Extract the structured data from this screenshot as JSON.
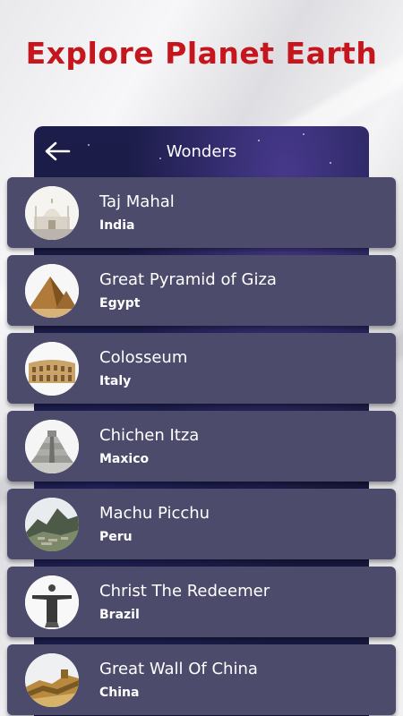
{
  "app": {
    "title": "Explore Planet Earth"
  },
  "header": {
    "title": "Wonders",
    "back_icon": "arrow-left-icon"
  },
  "wonders": [
    {
      "name": "Taj Mahal",
      "country": "India",
      "icon": "taj-mahal-icon"
    },
    {
      "name": "Great Pyramid of Giza",
      "country": "Egypt",
      "icon": "pyramid-icon"
    },
    {
      "name": "Colosseum",
      "country": "Italy",
      "icon": "colosseum-icon"
    },
    {
      "name": "Chichen Itza",
      "country": "Maxico",
      "icon": "chichen-itza-icon"
    },
    {
      "name": "Machu Picchu",
      "country": "Peru",
      "icon": "machu-picchu-icon"
    },
    {
      "name": "Christ The Redeemer",
      "country": "Brazil",
      "icon": "christ-redeemer-icon"
    },
    {
      "name": "Great Wall Of China",
      "country": "China",
      "icon": "great-wall-icon"
    }
  ],
  "colors": {
    "title_red": "#c4161c",
    "card_bg": "#4d4b6b",
    "panel_bg": "#1c1d4a"
  }
}
